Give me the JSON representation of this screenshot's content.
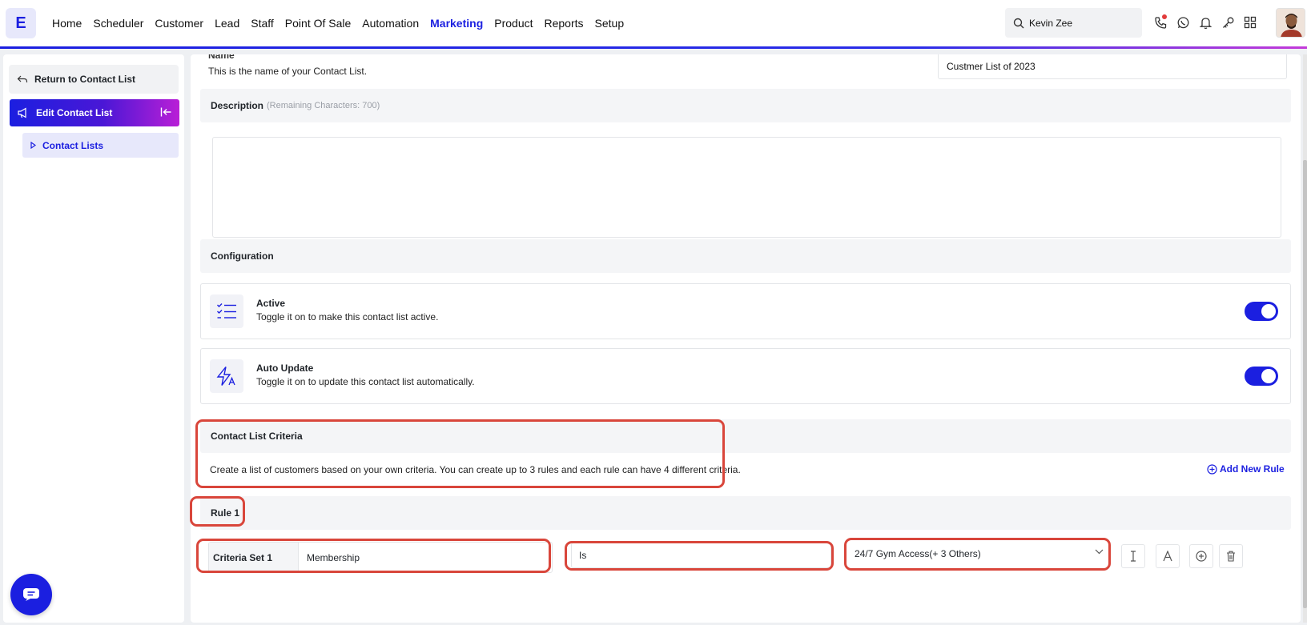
{
  "app": {
    "logo_letter": "E",
    "accent": "#1b1fe0",
    "highlight": "#d9463b"
  },
  "nav": {
    "items": [
      "Home",
      "Scheduler",
      "Customer",
      "Lead",
      "Staff",
      "Point Of Sale",
      "Automation",
      "Marketing",
      "Product",
      "Reports",
      "Setup"
    ],
    "active": "Marketing"
  },
  "search": {
    "value": "Kevin Zee",
    "icon": "search-icon"
  },
  "top_icons": [
    "phone-icon",
    "whatsapp-icon",
    "bell-icon",
    "key-icon",
    "apps-grid-icon"
  ],
  "sidebar": {
    "return_label": "Return to Contact List",
    "edit_label": "Edit Contact List",
    "contact_lists_label": "Contact Lists"
  },
  "form": {
    "name_label": "Name",
    "name_help": "This is the name of your Contact List.",
    "name_value": "Custmer List of 2023",
    "description_label": "Description",
    "description_remaining": "(Remaining Characters: 700)",
    "description_value": "",
    "configuration_label": "Configuration",
    "active": {
      "title": "Active",
      "desc": "Toggle it on to make this contact list active.",
      "on": true
    },
    "auto_update": {
      "title": "Auto Update",
      "desc": "Toggle it on to update this contact list automatically.",
      "on": true
    },
    "criteria": {
      "title": "Contact List Criteria",
      "desc": "Create a list of customers based on your own criteria. You can create up to 3 rules and each rule can have 4 different criteria.",
      "add_rule": "Add New Rule"
    },
    "rule": {
      "title": "Rule 1",
      "set_label": "Criteria Set 1",
      "field": "Membership",
      "operator": "Is",
      "value": "24/7 Gym Access(+ 3 Others)"
    }
  }
}
